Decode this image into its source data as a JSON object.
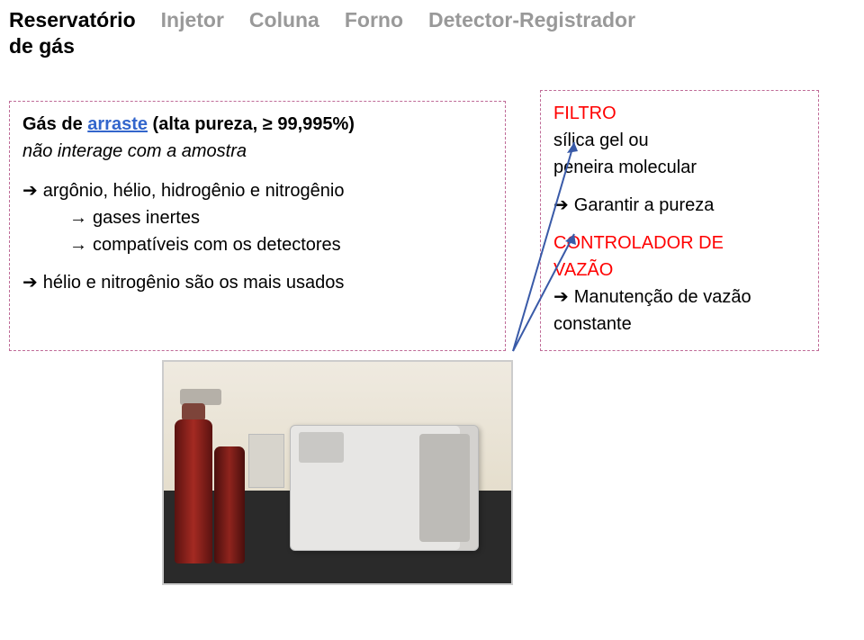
{
  "header": {
    "item1_line1": "Reservatório",
    "item1_line2": "de gás",
    "item2": "Injetor",
    "item3": "Coluna",
    "item4": "Forno",
    "item5": "Detector-Registrador"
  },
  "left_box": {
    "title_prefix": "Gás de ",
    "title_link": "arraste",
    "title_suffix": " (alta pureza, ≥ 99,995%)",
    "subhead": "não interage com a amostra",
    "line1": "argônio, hélio, hidrogênio e nitrogênio",
    "line2": "gases inertes",
    "line3": "compatíveis com os detectores",
    "line4": "hélio e nitrogênio são os mais usados"
  },
  "right_box": {
    "filtro_label": "FILTRO",
    "filtro_text1": "sílica gel ou",
    "filtro_text2": "peneira molecular",
    "garantir": "Garantir a pureza",
    "vazao_label1": "CONTROLADOR DE",
    "vazao_label2": "VAZÃO",
    "vazao_text1": "Manutenção de vazão",
    "vazao_text2": "constante"
  }
}
